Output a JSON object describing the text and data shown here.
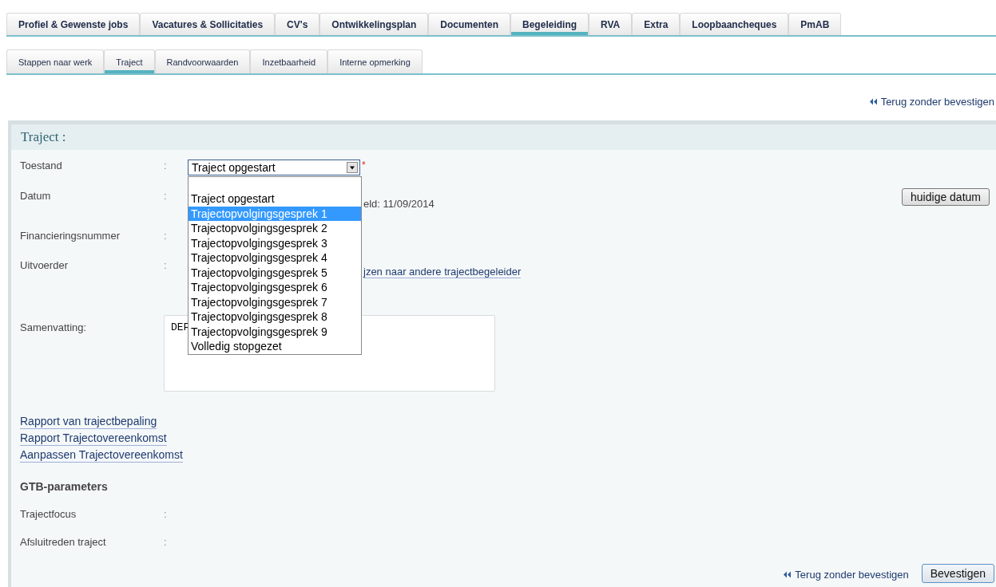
{
  "main_tabs": [
    {
      "label": "Profiel & Gewenste jobs",
      "selected": false
    },
    {
      "label": "Vacatures & Sollicitaties",
      "selected": false
    },
    {
      "label": "CV's",
      "selected": false
    },
    {
      "label": "Ontwikkelingsplan",
      "selected": false
    },
    {
      "label": "Documenten",
      "selected": false
    },
    {
      "label": "Begeleiding",
      "selected": true
    },
    {
      "label": "RVA",
      "selected": false
    },
    {
      "label": "Extra",
      "selected": false
    },
    {
      "label": "Loopbaancheques",
      "selected": false
    },
    {
      "label": "PmAB",
      "selected": false
    }
  ],
  "sub_tabs": [
    {
      "label": "Stappen naar werk",
      "selected": false
    },
    {
      "label": "Traject",
      "selected": true
    },
    {
      "label": "Randvoorwaarden",
      "selected": false
    },
    {
      "label": "Inzetbaarheid",
      "selected": false
    },
    {
      "label": "Interne opmerking",
      "selected": false
    }
  ],
  "top_link": "Terug zonder bevestigen",
  "section": {
    "title": "Traject :",
    "toestand": {
      "label": "Toestand",
      "colon": ":",
      "value": "Traject opgestart",
      "required": "*",
      "expanded": true,
      "options": [
        {
          "label": "Traject opgestart",
          "highlighted": false
        },
        {
          "label": "Trajectopvolgingsgesprek 1",
          "highlighted": true
        },
        {
          "label": "Trajectopvolgingsgesprek 2",
          "highlighted": false
        },
        {
          "label": "Trajectopvolgingsgesprek 3",
          "highlighted": false
        },
        {
          "label": "Trajectopvolgingsgesprek 4",
          "highlighted": false
        },
        {
          "label": "Trajectopvolgingsgesprek 5",
          "highlighted": false
        },
        {
          "label": "Trajectopvolgingsgesprek 6",
          "highlighted": false
        },
        {
          "label": "Trajectopvolgingsgesprek 7",
          "highlighted": false
        },
        {
          "label": "Trajectopvolgingsgesprek 8",
          "highlighted": false
        },
        {
          "label": "Trajectopvolgingsgesprek 9",
          "highlighted": false
        },
        {
          "label": "Volledig stopgezet",
          "highlighted": false
        }
      ]
    },
    "datum": {
      "label": "Datum",
      "colon": ":",
      "partial_text": "eld: 11/09/2014",
      "button": "huidige datum"
    },
    "financiering": {
      "label": "Financieringsnummer",
      "colon": ":"
    },
    "uitvoerder": {
      "label": "Uitvoerder",
      "colon": ":",
      "partial_link": "jzen naar andere trajectbegeleider"
    },
    "samenvatting": {
      "label": "Samenvatting:",
      "partial_value": "DEF"
    },
    "links": [
      "Rapport van trajectbepaling",
      "Rapport Trajectovereenkomst",
      "Aanpassen Trajectovereenkomst"
    ],
    "gtb_title": "GTB-parameters",
    "gtb_fields": [
      {
        "label": "Trajectfocus",
        "colon": ":"
      },
      {
        "label": "Afsluitreden traject",
        "colon": ":"
      }
    ],
    "back_link": "Terug zonder bevestigen",
    "confirm": "Bevestigen"
  }
}
